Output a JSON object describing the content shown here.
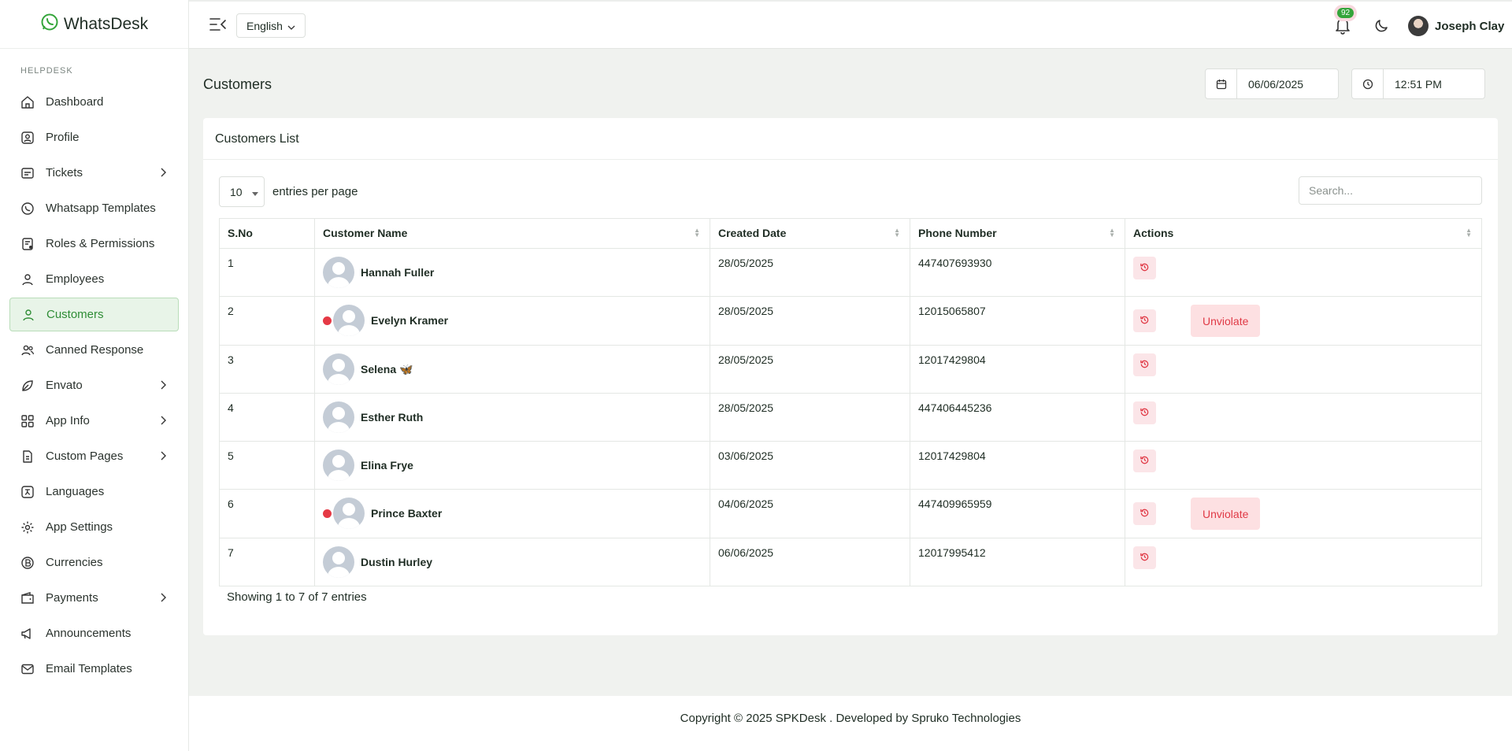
{
  "brand": {
    "name": "WhatsDesk"
  },
  "sidebar": {
    "section": "HELPDESK",
    "items": [
      {
        "label": "Dashboard",
        "icon": "home-icon",
        "has_submenu": false,
        "active": false
      },
      {
        "label": "Profile",
        "icon": "profile-icon",
        "has_submenu": false,
        "active": false
      },
      {
        "label": "Tickets",
        "icon": "ticket-icon",
        "has_submenu": true,
        "active": false
      },
      {
        "label": "Whatsapp Templates",
        "icon": "whatsapp-icon",
        "has_submenu": false,
        "active": false
      },
      {
        "label": "Roles & Permissions",
        "icon": "roles-icon",
        "has_submenu": false,
        "active": false
      },
      {
        "label": "Employees",
        "icon": "employee-icon",
        "has_submenu": false,
        "active": false
      },
      {
        "label": "Customers",
        "icon": "customer-icon",
        "has_submenu": false,
        "active": true
      },
      {
        "label": "Canned Response",
        "icon": "users-icon",
        "has_submenu": false,
        "active": false
      },
      {
        "label": "Envato",
        "icon": "leaf-icon",
        "has_submenu": true,
        "active": false
      },
      {
        "label": "App Info",
        "icon": "apps-icon",
        "has_submenu": true,
        "active": false
      },
      {
        "label": "Custom Pages",
        "icon": "page-icon",
        "has_submenu": true,
        "active": false
      },
      {
        "label": "Languages",
        "icon": "language-icon",
        "has_submenu": false,
        "active": false
      },
      {
        "label": "App Settings",
        "icon": "settings-icon",
        "has_submenu": false,
        "active": false
      },
      {
        "label": "Currencies",
        "icon": "currency-icon",
        "has_submenu": false,
        "active": false
      },
      {
        "label": "Payments",
        "icon": "wallet-icon",
        "has_submenu": true,
        "active": false
      },
      {
        "label": "Announcements",
        "icon": "megaphone-icon",
        "has_submenu": false,
        "active": false
      },
      {
        "label": "Email Templates",
        "icon": "mail-icon",
        "has_submenu": false,
        "active": false
      }
    ]
  },
  "header": {
    "language": "English",
    "notification_count": "92",
    "user_name": "Joseph Clay"
  },
  "page": {
    "title": "Customers",
    "date": "06/06/2025",
    "time": "12:51 PM"
  },
  "card": {
    "title": "Customers List",
    "page_size": "10",
    "entries_label": "entries per page",
    "search_placeholder": "Search...",
    "columns": [
      "S.No",
      "Customer Name",
      "Created Date",
      "Phone Number",
      "Actions"
    ],
    "rows": [
      {
        "sno": "1",
        "name": "Hannah Fuller",
        "created": "28/05/2025",
        "phone": "447407693930",
        "violated": false
      },
      {
        "sno": "2",
        "name": "Evelyn Kramer",
        "created": "28/05/2025",
        "phone": "12015065807",
        "violated": true
      },
      {
        "sno": "3",
        "name": "Selena 🦋",
        "created": "28/05/2025",
        "phone": "12017429804",
        "violated": false
      },
      {
        "sno": "4",
        "name": "Esther Ruth",
        "created": "28/05/2025",
        "phone": "447406445236",
        "violated": false
      },
      {
        "sno": "5",
        "name": "Elina Frye",
        "created": "03/06/2025",
        "phone": "12017429804",
        "violated": false
      },
      {
        "sno": "6",
        "name": "Prince Baxter",
        "created": "04/06/2025",
        "phone": "447409965959",
        "violated": true
      },
      {
        "sno": "7",
        "name": "Dustin Hurley",
        "created": "06/06/2025",
        "phone": "12017995412",
        "violated": false
      }
    ],
    "unviolate_label": "Unviolate",
    "showing": "Showing 1 to 7 of 7 entries"
  },
  "footer": {
    "text": "Copyright © 2025 SPKDesk . Developed by Spruko Technologies"
  },
  "colors": {
    "accent": "#34a53a",
    "danger": "#e03a46",
    "danger_bg": "#fde0e2"
  }
}
